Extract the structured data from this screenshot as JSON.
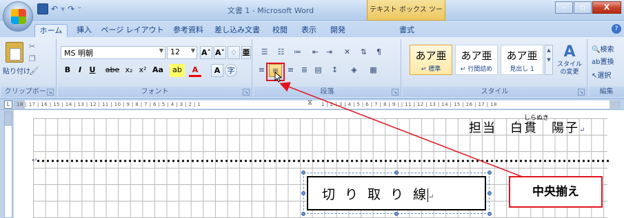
{
  "window": {
    "title": "文書 1 - Microsoft Word",
    "context_tab": "テキスト ボックス ツール",
    "controls": {
      "minimize": "–",
      "maximize": "▫",
      "close": "X"
    }
  },
  "tabs": [
    "ホーム",
    "挿入",
    "ページ レイアウト",
    "参考資料",
    "差し込み文書",
    "校閲",
    "表示",
    "開発",
    "書式"
  ],
  "ribbon": {
    "clipboard": {
      "paste": "貼り付け",
      "label": "クリップボー..."
    },
    "font": {
      "name": "MS 明朝",
      "size": "12",
      "label": "フォント",
      "buttons": [
        "B",
        "I",
        "U",
        "abe",
        "x₂",
        "x²",
        "Aa",
        "A"
      ]
    },
    "paragraph": {
      "label": "段落"
    },
    "styles": {
      "items": [
        {
          "sample": "あア亜",
          "name": "↵ 標準"
        },
        {
          "sample": "あア亜",
          "name": "↵ 行間詰め"
        },
        {
          "sample": "あア亜",
          "name": "見出し 1"
        }
      ],
      "change": "スタイルの変更",
      "label": "スタイル"
    },
    "editing": {
      "find": "検索",
      "replace": "置換",
      "select": "選択",
      "label": "編集"
    }
  },
  "ruler": {
    "left_text": "18 | 17 | 16 | 15 | 14 | 13 | 12 | 11 | 10 | 9 | 8 | 7 | 6 | 5 | 4 | 3 | 2 | 1",
    "right_text": "1 | 2 | 3 | 4 | 5 | 6 | 7 | 8 | 9 |   | 11 | 12 | 13 | 14 | 15 | 16 | 17 | 18"
  },
  "document": {
    "tanto": "担当　白貫　陽子",
    "ruby": "しらぬき",
    "textbox_text": "切り取り線",
    "para_mark": "↵"
  },
  "annotation": {
    "callout": "中央揃え"
  }
}
